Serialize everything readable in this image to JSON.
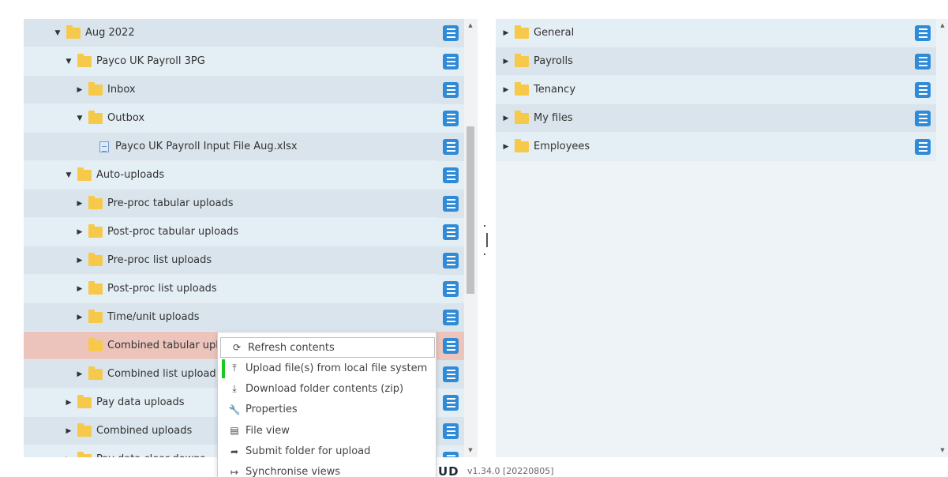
{
  "left_tree": {
    "rows": [
      {
        "label": "Aug 2022",
        "caret": "▼",
        "icon": "folder-icon",
        "indent": 1,
        "tone": "dark"
      },
      {
        "label": "Payco UK Payroll 3PG",
        "caret": "▼",
        "icon": "folder-icon",
        "indent": 2,
        "tone": "light"
      },
      {
        "label": "Inbox",
        "caret": "▶",
        "icon": "folder-icon",
        "indent": 3,
        "tone": "dark"
      },
      {
        "label": "Outbox",
        "caret": "▼",
        "icon": "folder-icon",
        "indent": 3,
        "tone": "light"
      },
      {
        "label": "Payco UK Payroll Input File Aug.xlsx",
        "caret": "",
        "icon": "spreadsheet-file-icon",
        "indent": 4,
        "tone": "dark"
      },
      {
        "label": "Auto-uploads",
        "caret": "▼",
        "icon": "folder-icon",
        "indent": 2,
        "tone": "light"
      },
      {
        "label": "Pre-proc tabular uploads",
        "caret": "▶",
        "icon": "folder-icon",
        "indent": 3,
        "tone": "dark"
      },
      {
        "label": "Post-proc tabular uploads",
        "caret": "▶",
        "icon": "folder-icon",
        "indent": 3,
        "tone": "light"
      },
      {
        "label": "Pre-proc list uploads",
        "caret": "▶",
        "icon": "folder-icon",
        "indent": 3,
        "tone": "dark"
      },
      {
        "label": "Post-proc list uploads",
        "caret": "▶",
        "icon": "folder-icon",
        "indent": 3,
        "tone": "light"
      },
      {
        "label": "Time/unit uploads",
        "caret": "▶",
        "icon": "folder-icon",
        "indent": 3,
        "tone": "dark"
      },
      {
        "label": "Combined tabular upl",
        "caret": "",
        "icon": "folder-icon",
        "indent": 3,
        "tone": "highlight"
      },
      {
        "label": "Combined list upload",
        "caret": "▶",
        "icon": "folder-icon",
        "indent": 3,
        "tone": "dark"
      },
      {
        "label": "Pay data uploads",
        "caret": "▶",
        "icon": "folder-icon",
        "indent": 2,
        "tone": "light"
      },
      {
        "label": "Combined uploads",
        "caret": "▶",
        "icon": "folder-icon",
        "indent": 2,
        "tone": "dark"
      },
      {
        "label": "Pay data clear-downs",
        "caret": "▶",
        "icon": "folder-icon",
        "indent": 2,
        "tone": "light"
      }
    ]
  },
  "right_tree": {
    "rows": [
      {
        "label": "General",
        "caret": "▶",
        "icon": "folder-icon",
        "tone": "light"
      },
      {
        "label": "Payrolls",
        "caret": "▶",
        "icon": "folder-icon",
        "tone": "dark"
      },
      {
        "label": "Tenancy",
        "caret": "▶",
        "icon": "folder-icon",
        "tone": "light"
      },
      {
        "label": "My files",
        "caret": "▶",
        "icon": "folder-icon",
        "tone": "dark"
      },
      {
        "label": "Employees",
        "caret": "▶",
        "icon": "folder-icon",
        "tone": "light"
      }
    ]
  },
  "context_menu": {
    "items": [
      {
        "label": "Refresh contents",
        "icon": "refresh-icon",
        "glyph": "⟳"
      },
      {
        "label": "Upload file(s) from local file system",
        "icon": "upload-icon",
        "glyph": "⤒"
      },
      {
        "label": "Download folder contents (zip)",
        "icon": "download-icon",
        "glyph": "⤓"
      },
      {
        "label": "Properties",
        "icon": "wrench-icon",
        "glyph": "🔧"
      },
      {
        "label": "File view",
        "icon": "file-view-icon",
        "glyph": "▤"
      },
      {
        "label": "Submit folder for upload",
        "icon": "share-arrow-icon",
        "glyph": "➦"
      },
      {
        "label": "Synchronise views",
        "icon": "sync-arrow-icon",
        "glyph": "↦"
      }
    ]
  },
  "footer": {
    "logo": "UD",
    "version": "v1.34.0 [20220805]"
  },
  "colors": {
    "row_light": "#e4eef5",
    "row_dark": "#d9e4ec",
    "row_highlight": "#ecc4bc",
    "menu_button": "#2f8bd7",
    "folder": "#f7c94a",
    "focus_bar": "#19c91f"
  }
}
